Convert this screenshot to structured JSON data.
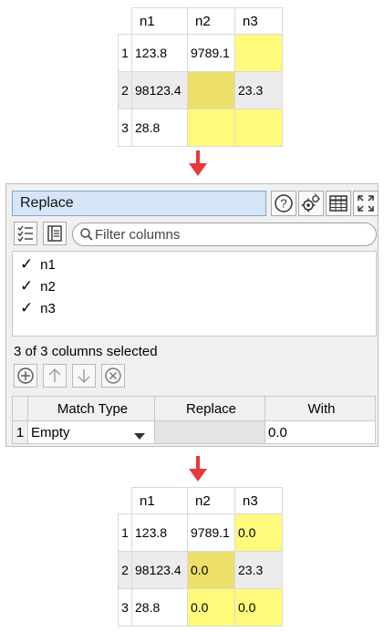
{
  "top_table": {
    "columns": [
      "n1",
      "n2",
      "n3"
    ],
    "rows": [
      {
        "num": "1",
        "n1": "123.8",
        "n2": "9789.1",
        "n3": ""
      },
      {
        "num": "2",
        "n1": "98123.4",
        "n2": "",
        "n3": "23.3"
      },
      {
        "num": "3",
        "n1": "28.8",
        "n2": "",
        "n3": ""
      }
    ]
  },
  "panel": {
    "title": "Replace",
    "filter_placeholder": "Filter columns",
    "columns": [
      "n1",
      "n2",
      "n3"
    ],
    "status": "3 of 3 columns selected",
    "table": {
      "headers": [
        "Match Type",
        "Replace",
        "With"
      ],
      "rows": [
        {
          "num": "1",
          "match_type": "Empty",
          "replace": "",
          "with": "0.0"
        }
      ]
    },
    "icons": {
      "help": "help-icon",
      "settings": "settings-gears-icon",
      "table": "table-view-icon",
      "expand": "expand-icon"
    }
  },
  "bottom_table": {
    "columns": [
      "n1",
      "n2",
      "n3"
    ],
    "rows": [
      {
        "num": "1",
        "n1": "123.8",
        "n2": "9789.1",
        "n3": "0.0"
      },
      {
        "num": "2",
        "n1": "98123.4",
        "n2": "0.0",
        "n3": "23.3"
      },
      {
        "num": "3",
        "n1": "28.8",
        "n2": "0.0",
        "n3": "0.0"
      }
    ]
  },
  "colors": {
    "highlight": "#fffa7a",
    "highlight_alt": "#ece06a",
    "arrow": "#e8383a",
    "title_bg": "#d6e6f6"
  }
}
